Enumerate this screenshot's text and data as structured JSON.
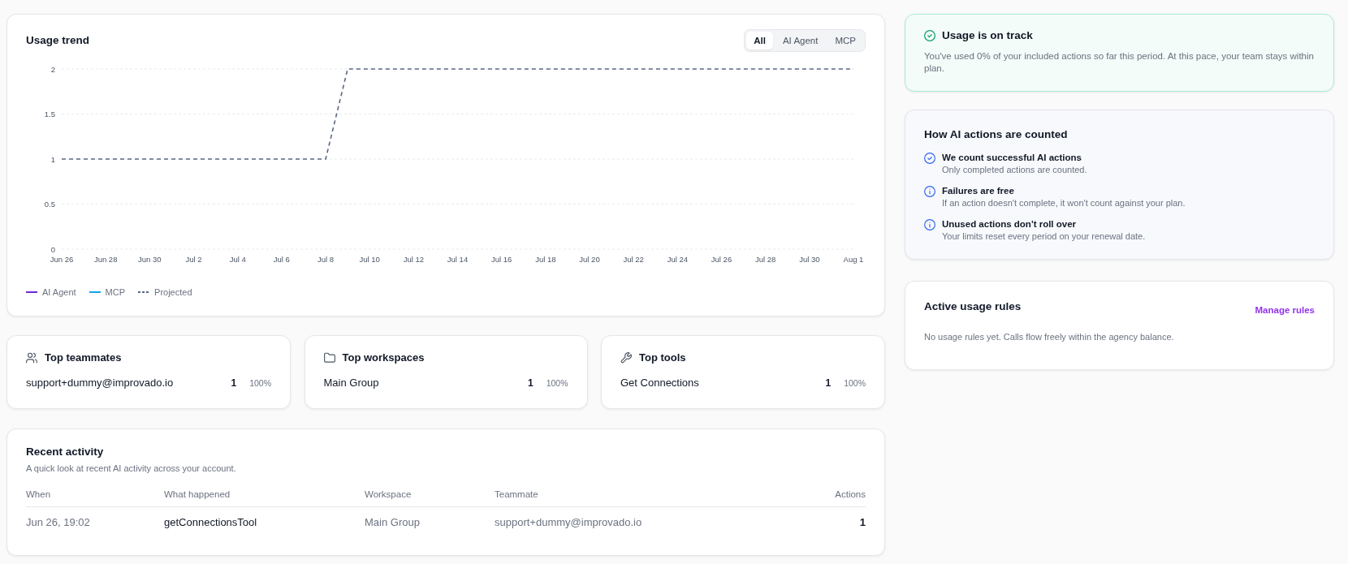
{
  "usage_trend": {
    "title": "Usage trend",
    "filter_tabs": [
      {
        "label": "All",
        "selected": true
      },
      {
        "label": "AI Agent",
        "selected": false
      },
      {
        "label": "MCP",
        "selected": false
      }
    ],
    "chart_data": {
      "type": "line",
      "categories": [
        "Jun 26",
        null,
        "Jun 28",
        null,
        "Jun 30",
        null,
        "Jul 2",
        null,
        "Jul 4",
        null,
        "Jul 6",
        null,
        "Jul 8",
        null,
        "Jul 10",
        null,
        "Jul 12",
        null,
        "Jul 14",
        null,
        "Jul 16",
        null,
        "Jul 18",
        null,
        "Jul 20",
        null,
        "Jul 22",
        null,
        "Jul 24",
        null,
        "Jul 26",
        null,
        "Jul 28",
        null,
        "Jul 30",
        null,
        "Aug 1"
      ],
      "series": [
        {
          "name": "AI Agent",
          "color": "#6d28d9",
          "line_style": "solid",
          "values": [
            null,
            null,
            null,
            null,
            null,
            null,
            null,
            null,
            null,
            null,
            null,
            null,
            null,
            null,
            null,
            null,
            null,
            null,
            null,
            null,
            null,
            null,
            null,
            null,
            null,
            null,
            null,
            null,
            null,
            null,
            null,
            null,
            null,
            null,
            null,
            null,
            null
          ]
        },
        {
          "name": "MCP",
          "color": "#0ea5e9",
          "line_style": "solid",
          "values": [
            null,
            null,
            null,
            null,
            null,
            null,
            null,
            null,
            null,
            null,
            null,
            null,
            null,
            null,
            null,
            null,
            null,
            null,
            null,
            null,
            null,
            null,
            null,
            null,
            null,
            null,
            null,
            null,
            null,
            null,
            null,
            null,
            null,
            null,
            null,
            null,
            null
          ]
        },
        {
          "name": "Projected",
          "color": "#5b6881",
          "line_style": "dashed",
          "values": [
            1,
            1,
            1,
            1,
            1,
            1,
            1,
            1,
            1,
            1,
            1,
            1,
            1,
            2,
            2,
            2,
            2,
            2,
            2,
            2,
            2,
            2,
            2,
            2,
            2,
            2,
            2,
            2,
            2,
            2,
            2,
            2,
            2,
            2,
            2,
            2,
            2
          ]
        }
      ],
      "ylim": [
        0,
        2
      ],
      "yticks": [
        0,
        0.5,
        1,
        1.5,
        2
      ],
      "grid": true
    }
  },
  "top_lists": [
    {
      "kind": "teammates",
      "title": "Top teammates",
      "rows": [
        {
          "name": "support+dummy@improvado.io",
          "count": "1",
          "share": "100%"
        }
      ]
    },
    {
      "kind": "workspaces",
      "title": "Top workspaces",
      "rows": [
        {
          "name": "Main Group",
          "count": "1",
          "share": "100%"
        }
      ]
    },
    {
      "kind": "tools",
      "title": "Top tools",
      "rows": [
        {
          "name": "Get Connections",
          "count": "1",
          "share": "100%"
        }
      ]
    }
  ],
  "recent_activity": {
    "title": "Recent activity",
    "subtitle": "A quick look at recent AI activity across your account.",
    "columns": [
      "When",
      "What happened",
      "Workspace",
      "Teammate",
      "Actions"
    ],
    "rows": [
      [
        "Jun 26, 19:02",
        "getConnectionsTool",
        "Main Group",
        "support+dummy@improvado.io",
        "1"
      ]
    ]
  },
  "usage_status": {
    "kind": "success",
    "title": "Usage is on track",
    "text": "You've used 0% of your included actions so far this period. At this pace, your team stays within plan."
  },
  "counting_rules": {
    "title": "How AI actions are counted",
    "items": [
      {
        "kind": "check",
        "title": "We count successful AI actions",
        "text": "Only completed actions are counted."
      },
      {
        "kind": "info",
        "title": "Failures are free",
        "text": "If an action doesn't complete, it won't count against your plan."
      },
      {
        "kind": "info",
        "title": "Unused actions don't roll over",
        "text": "Your limits reset every period on your renewal date."
      }
    ]
  },
  "usage_rules": {
    "title": "Active usage rules",
    "link": "Manage rules",
    "text": "No usage rules yet. Calls flow freely within the agency balance."
  }
}
